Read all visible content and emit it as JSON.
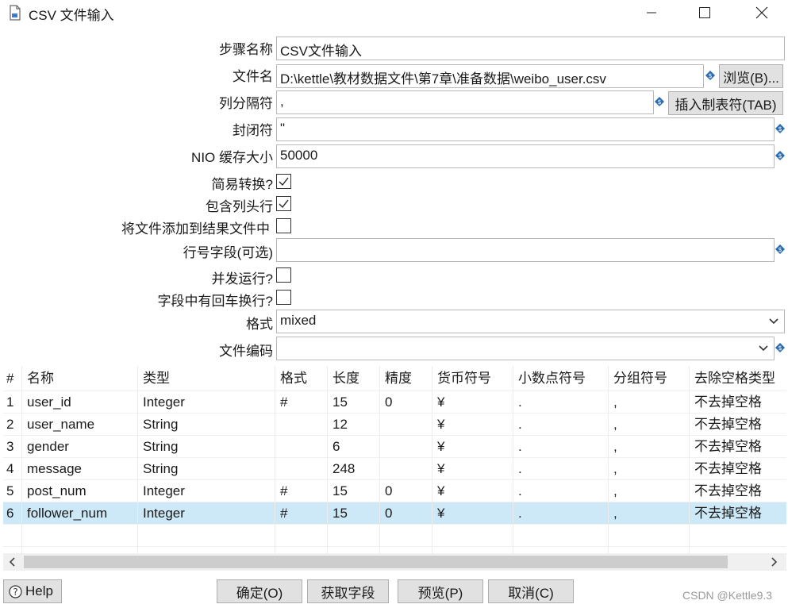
{
  "window": {
    "title": "CSV 文件输入"
  },
  "form": {
    "step_name_label": "步骤名称",
    "step_name_value": "CSV文件输入",
    "filename_label": "文件名",
    "filename_value": "D:\\kettle\\教材数据文件\\第7章\\准备数据\\weibo_user.csv",
    "browse_button": "浏览(B)...",
    "delimiter_label": "列分隔符",
    "delimiter_value": ",",
    "insert_tab_button": "插入制表符(TAB)",
    "enclosure_label": "封闭符",
    "enclosure_value": "\"",
    "nio_label": "NIO 缓存大小",
    "nio_value": "50000",
    "lazy_conversion_label": "简易转换?",
    "lazy_conversion_checked": true,
    "header_row_label": "包含列头行",
    "header_row_checked": true,
    "add_filename_label": "将文件添加到结果文件中",
    "add_filename_checked": false,
    "rownum_field_label": "行号字段(可选)",
    "rownum_field_value": "",
    "parallel_label": "并发运行?",
    "parallel_checked": false,
    "newline_label": "字段中有回车换行?",
    "newline_checked": false,
    "format_label": "格式",
    "format_value": "mixed",
    "encoding_label": "文件编码",
    "encoding_value": ""
  },
  "table": {
    "headers": [
      "#",
      "名称",
      "类型",
      "格式",
      "长度",
      "精度",
      "货币符号",
      "小数点符号",
      "分组符号",
      "去除空格类型"
    ],
    "rows": [
      [
        "1",
        "user_id",
        "Integer",
        "#",
        "15",
        "0",
        "¥",
        ".",
        ",",
        "不去掉空格"
      ],
      [
        "2",
        "user_name",
        "String",
        "",
        "12",
        "",
        "¥",
        ".",
        ",",
        "不去掉空格"
      ],
      [
        "3",
        "gender",
        "String",
        "",
        "6",
        "",
        "¥",
        ".",
        ",",
        "不去掉空格"
      ],
      [
        "4",
        "message",
        "String",
        "",
        "248",
        "",
        "¥",
        ".",
        ",",
        "不去掉空格"
      ],
      [
        "5",
        "post_num",
        "Integer",
        "#",
        "15",
        "0",
        "¥",
        ".",
        ",",
        "不去掉空格"
      ],
      [
        "6",
        "follower_num",
        "Integer",
        "#",
        "15",
        "0",
        "¥",
        ".",
        ",",
        "不去掉空格"
      ]
    ],
    "selected_row": 6
  },
  "buttons": {
    "help": "Help",
    "ok": "确定(O)",
    "get_fields": "获取字段",
    "preview": "预览(P)",
    "cancel": "取消(C)"
  },
  "watermark": "CSDN @Kettle9.3"
}
